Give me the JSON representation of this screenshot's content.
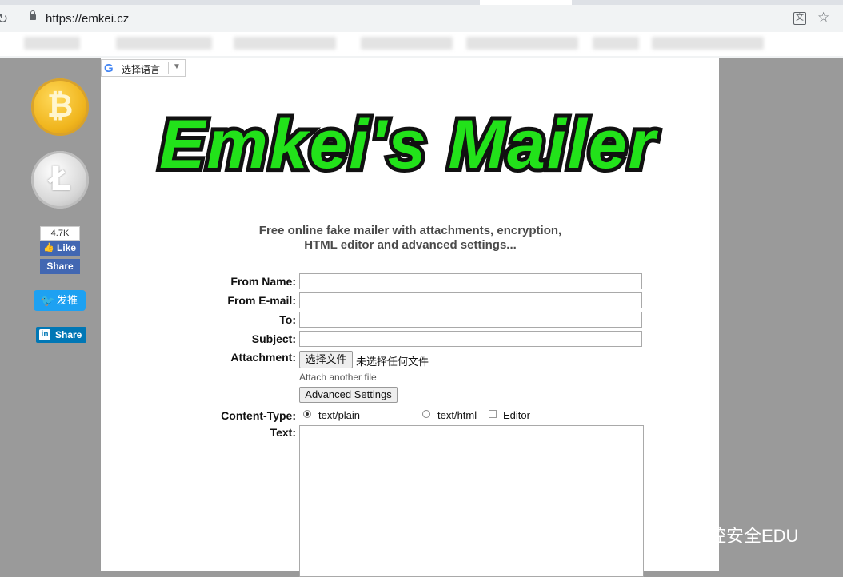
{
  "browser": {
    "url": "https://emkei.cz"
  },
  "lang_widget": {
    "text": "选择语言",
    "google_letter": "G",
    "arrow": "▼"
  },
  "logo_text": "Emkei's Mailer",
  "tagline": {
    "line1": "Free online fake mailer with attachments, encryption,",
    "line2": "HTML editor and advanced settings..."
  },
  "form": {
    "from_name_label": "From Name:",
    "from_email_label": "From E-mail:",
    "to_label": "To:",
    "subject_label": "Subject:",
    "attachment_label": "Attachment:",
    "choose_file_button": "选择文件",
    "no_file_text": "未选择任何文件",
    "attach_another": "Attach another file",
    "advanced_settings_button": "Advanced Settings",
    "content_type_label": "Content-Type:",
    "content_type_options": [
      "text/plain",
      "text/html"
    ],
    "content_type_selected": "text/plain",
    "editor_label": "Editor",
    "text_label": "Text:"
  },
  "sidebar": {
    "bitcoin_symbol": "₿",
    "litecoin_symbol": "Ł",
    "fb_count": "4.7K",
    "fb_like": "Like",
    "fb_share": "Share",
    "twitter": "发推",
    "linkedin": "Share",
    "linkedin_logo": "in"
  },
  "watermark": "掌控安全EDU",
  "colors": {
    "page_bg": "#9a9a9a",
    "logo_green": "#22e21a",
    "facebook": "#4267b2",
    "twitter": "#1da1f2",
    "linkedin": "#0077b5"
  }
}
